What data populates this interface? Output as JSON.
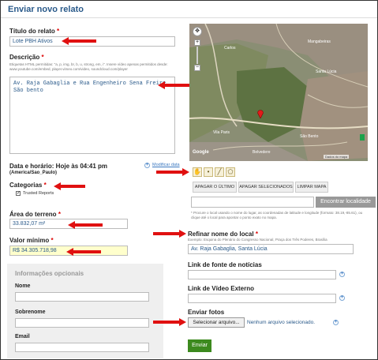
{
  "page": {
    "title": "Enviar novo relato"
  },
  "colors": {
    "accent": "#2a5a8a",
    "required": "#dd0000",
    "arrow": "#e01010",
    "submit": "#3c8a1e",
    "highlight_field": "#ffffcc"
  },
  "form": {
    "title_label": "Título do relato",
    "title_value": "Lote PBH Ativos",
    "description_label": "Descrição",
    "description_hint": "Etiquetas HTML permitidas: \"a, p, img, br, b, u, strong, em, i\". Insere vídeo apenas permitidos desde: www.youtube.com/embed, player.vimeo.com/video, soundcloud.com/player",
    "description_value": "Av. Raja Gabaglia e Rua Engenheiro Sena Freire, São bento",
    "date_label": "Data e horário: Hoje às 04:41 pm",
    "timezone": "(America/Sao_Paulo)",
    "modify_date": "Modificar data",
    "categories_label": "Categorias",
    "category_item": "Trusted Reports",
    "area_label": "Área do terreno",
    "area_value": "33.832,07 m²",
    "min_value_label": "Valor mínimo",
    "min_value": "R$ 34.305.718,98",
    "optional_title": "Informações opcionais",
    "name_label": "Nome",
    "surname_label": "Sobrenome",
    "email_label": "Email",
    "required_mark": "*"
  },
  "map": {
    "labels": {
      "a": "Carlos",
      "b": "Mangabeiras",
      "c": "Santa Lúcia",
      "d": "Vila Paris",
      "e": "São Bento",
      "f": "Belvedere"
    },
    "attribution": "Dados do mapa",
    "logo": "Google",
    "delete_last": "APAGAR O ÚLTIMO",
    "delete_selected": "APAGAR SELECIONADOS",
    "clear_map": "LIMPAR MAPA",
    "find_location": "Encontrar localidade",
    "location_hint": "* Procure o local usando o nome do lugar, as coordenadas de latitude e longitude (formato: 38.19,-85.61), ou clique até o local para apontar o ponto exato no mapa."
  },
  "right": {
    "refine_label": "Refinar nome do local",
    "refine_hint": "Exemplo: Esquina do Plenário do Congresso Nacional, Praça dos Três Poderes, Brasília",
    "refine_value": "Av. Raja Gabaglia, Santa Lúcia",
    "news_link_label": "Link de fonte de notícias",
    "video_link_label": "Link de Vídeo Externo",
    "photos_label": "Enviar fotos",
    "choose_file": "Selecionar arquivo...",
    "no_file": "Nenhum arquivo selecionado.",
    "submit": "Enviar"
  }
}
